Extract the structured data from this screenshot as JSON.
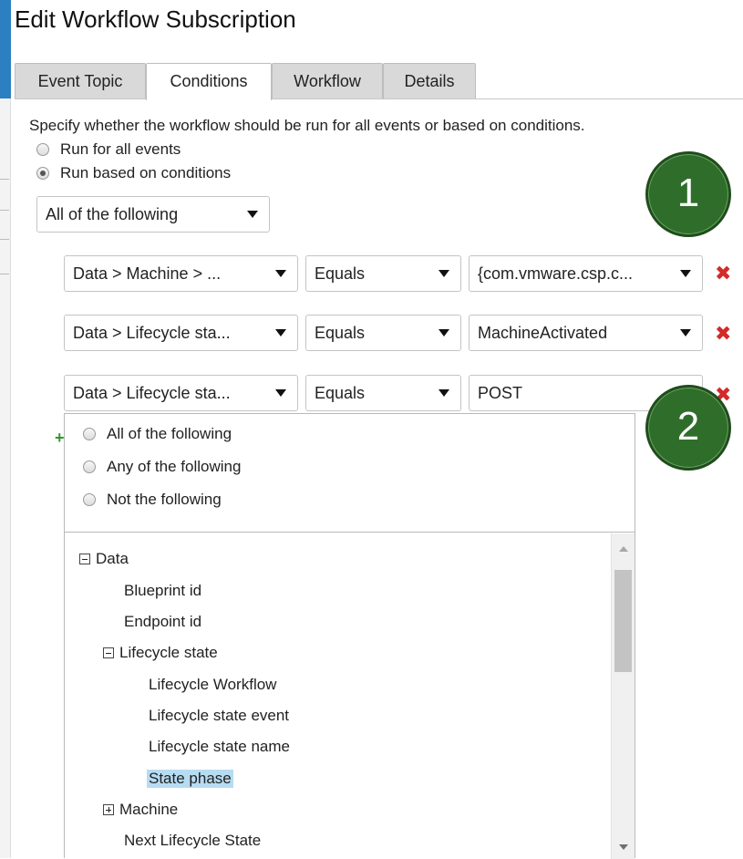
{
  "dialog": {
    "title": "Edit Workflow Subscription"
  },
  "tabs": [
    {
      "label": "Event Topic"
    },
    {
      "label": "Conditions"
    },
    {
      "label": "Workflow"
    },
    {
      "label": "Details"
    }
  ],
  "conditions": {
    "intro": "Specify whether the workflow should be run for all events or based on conditions.",
    "run_all_label": "Run for all events",
    "run_conditions_label": "Run based on conditions",
    "group_select": "All of the following",
    "rows": [
      {
        "field": "Data > Machine > ...",
        "operator": "Equals",
        "value": "{com.vmware.csp.c..."
      },
      {
        "field": "Data > Lifecycle sta...",
        "operator": "Equals",
        "value": "MachineActivated"
      },
      {
        "field": "Data > Lifecycle sta...",
        "operator": "Equals",
        "value": "POST"
      }
    ]
  },
  "dropdown": {
    "options": [
      "All of the following",
      "Any of the following",
      "Not the following"
    ],
    "tree": {
      "data": "Data",
      "blueprint_id": "Blueprint id",
      "endpoint_id": "Endpoint id",
      "lifecycle_state": "Lifecycle state",
      "lifecycle_workflow": "Lifecycle Workflow",
      "lifecycle_state_event": "Lifecycle state event",
      "lifecycle_state_name": "Lifecycle state name",
      "state_phase": "State phase",
      "machine": "Machine",
      "next_lifecycle_state": "Next Lifecycle State"
    }
  },
  "callouts": {
    "one": "1",
    "two": "2"
  },
  "colors": {
    "callout_green": "#2f6e2a",
    "remove_red": "#d42a2a",
    "selection_blue": "#b6dcf2",
    "tab_inactive": "#d9d9d9"
  }
}
